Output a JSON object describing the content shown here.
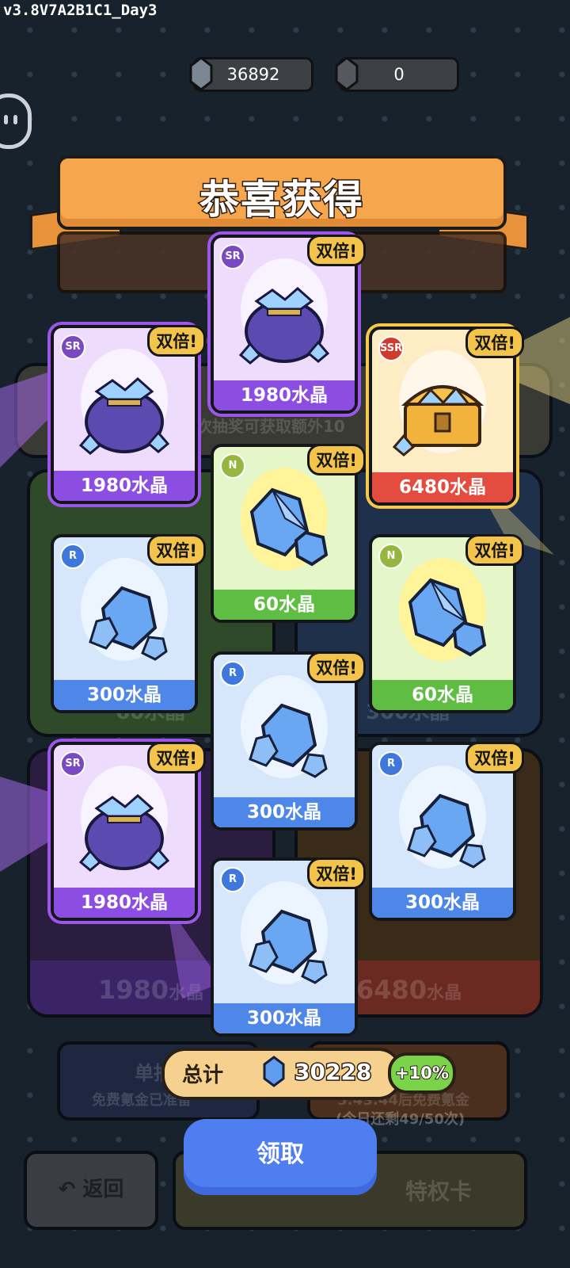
{
  "version": "v3.8V7A2B1C1_Day3",
  "currency": [
    {
      "icon": "crystal-icon",
      "value": "36892"
    },
    {
      "icon": "dark-crystal-icon",
      "value": "0"
    }
  ],
  "banner": {
    "title": "恭喜获得"
  },
  "background": {
    "hint": "次抽奖可获取额外10",
    "panel_value_left": "1980",
    "panel_value_right": "6480",
    "panel_unit": "水晶",
    "ghost_left": "60水晶",
    "ghost_right": "300水晶",
    "single_draw": "单抽",
    "free_ready": "免费氪金已准备",
    "timer": "5:43:44后免费氪金",
    "remaining": "(今日还剩49/50次)",
    "privilege": "特权卡"
  },
  "double_label": "双倍!",
  "cards": [
    {
      "rarity": "SR",
      "label": "1980水晶",
      "item": "crystal-bag-icon"
    },
    {
      "rarity": "SR",
      "label": "1980水晶",
      "item": "crystal-bag-icon"
    },
    {
      "rarity": "SSR",
      "label": "6480水晶",
      "item": "treasure-chest-icon"
    },
    {
      "rarity": "N",
      "label": "60水晶",
      "item": "crystal-icon"
    },
    {
      "rarity": "R",
      "label": "300水晶",
      "item": "crystal-cluster-icon"
    },
    {
      "rarity": "N",
      "label": "60水晶",
      "item": "crystal-icon"
    },
    {
      "rarity": "R",
      "label": "300水晶",
      "item": "crystal-cluster-icon"
    },
    {
      "rarity": "SR",
      "label": "1980水晶",
      "item": "crystal-bag-icon"
    },
    {
      "rarity": "R",
      "label": "300水晶",
      "item": "crystal-cluster-icon"
    },
    {
      "rarity": "R",
      "label": "300水晶",
      "item": "crystal-cluster-icon"
    }
  ],
  "total": {
    "label": "总计",
    "value": "30228",
    "bonus": "+10%"
  },
  "claim_button": "领取",
  "back_button": "返回",
  "colors": {
    "sr": "#8c4ee2",
    "ssr": "#e44c3f",
    "n": "#5fbd43",
    "r": "#4f87e9",
    "claim": "#4f7ef0"
  }
}
